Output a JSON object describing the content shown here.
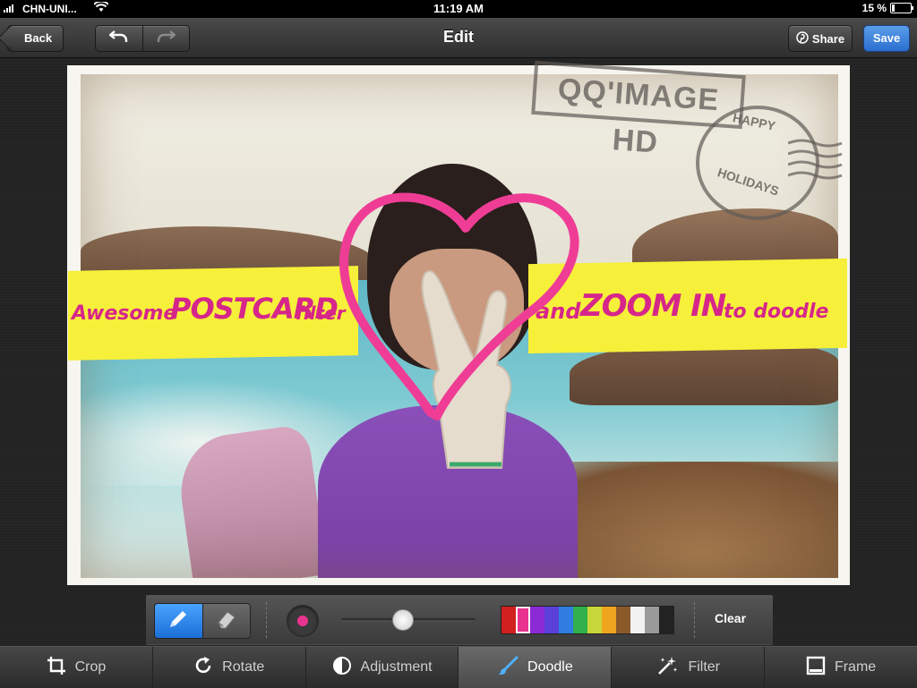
{
  "status_bar": {
    "carrier": "CHN-UNI...",
    "time": "11:19 AM",
    "battery_percent": "15 %",
    "battery_level": 0.15
  },
  "nav": {
    "back_label": "Back",
    "title": "Edit",
    "share_label": "Share",
    "save_label": "Save",
    "undo_icon": "undo-arrow",
    "redo_icon": "redo-arrow"
  },
  "photo": {
    "banner_left_text_1": "Awesome",
    "banner_left_text_2": "POSTCARD",
    "banner_left_text_3": "filter",
    "banner_right_text_1": "and",
    "banner_right_text_2": "ZOOM IN",
    "banner_right_text_3": "to doodle",
    "stamp_text": "QQ'IMAGE HD",
    "postmark_top": "HAPPY",
    "postmark_bottom": "HOLIDAYS",
    "doodle_color": "#ef3d96"
  },
  "doodle_toolbar": {
    "pen_icon": "pencil-icon",
    "eraser_icon": "eraser-icon",
    "brush_color": "#e8338f",
    "brush_size": 0.45,
    "palette": [
      "#d21f1f",
      "#e8338f",
      "#8a2bd6",
      "#5a3fd8",
      "#2f7de0",
      "#2fb04a",
      "#c7d63a",
      "#f0a51e",
      "#8b5a2b",
      "#f2f2f2",
      "#9a9a9a",
      "#222222"
    ],
    "selected_swatch_index": 1,
    "clear_label": "Clear"
  },
  "tabs": [
    {
      "label": "Crop",
      "icon": "crop-icon"
    },
    {
      "label": "Rotate",
      "icon": "rotate-icon"
    },
    {
      "label": "Adjustment",
      "icon": "adjustment-icon"
    },
    {
      "label": "Doodle",
      "icon": "brush-icon",
      "active": true
    },
    {
      "label": "Filter",
      "icon": "sparkle-icon"
    },
    {
      "label": "Frame",
      "icon": "frame-icon"
    }
  ]
}
